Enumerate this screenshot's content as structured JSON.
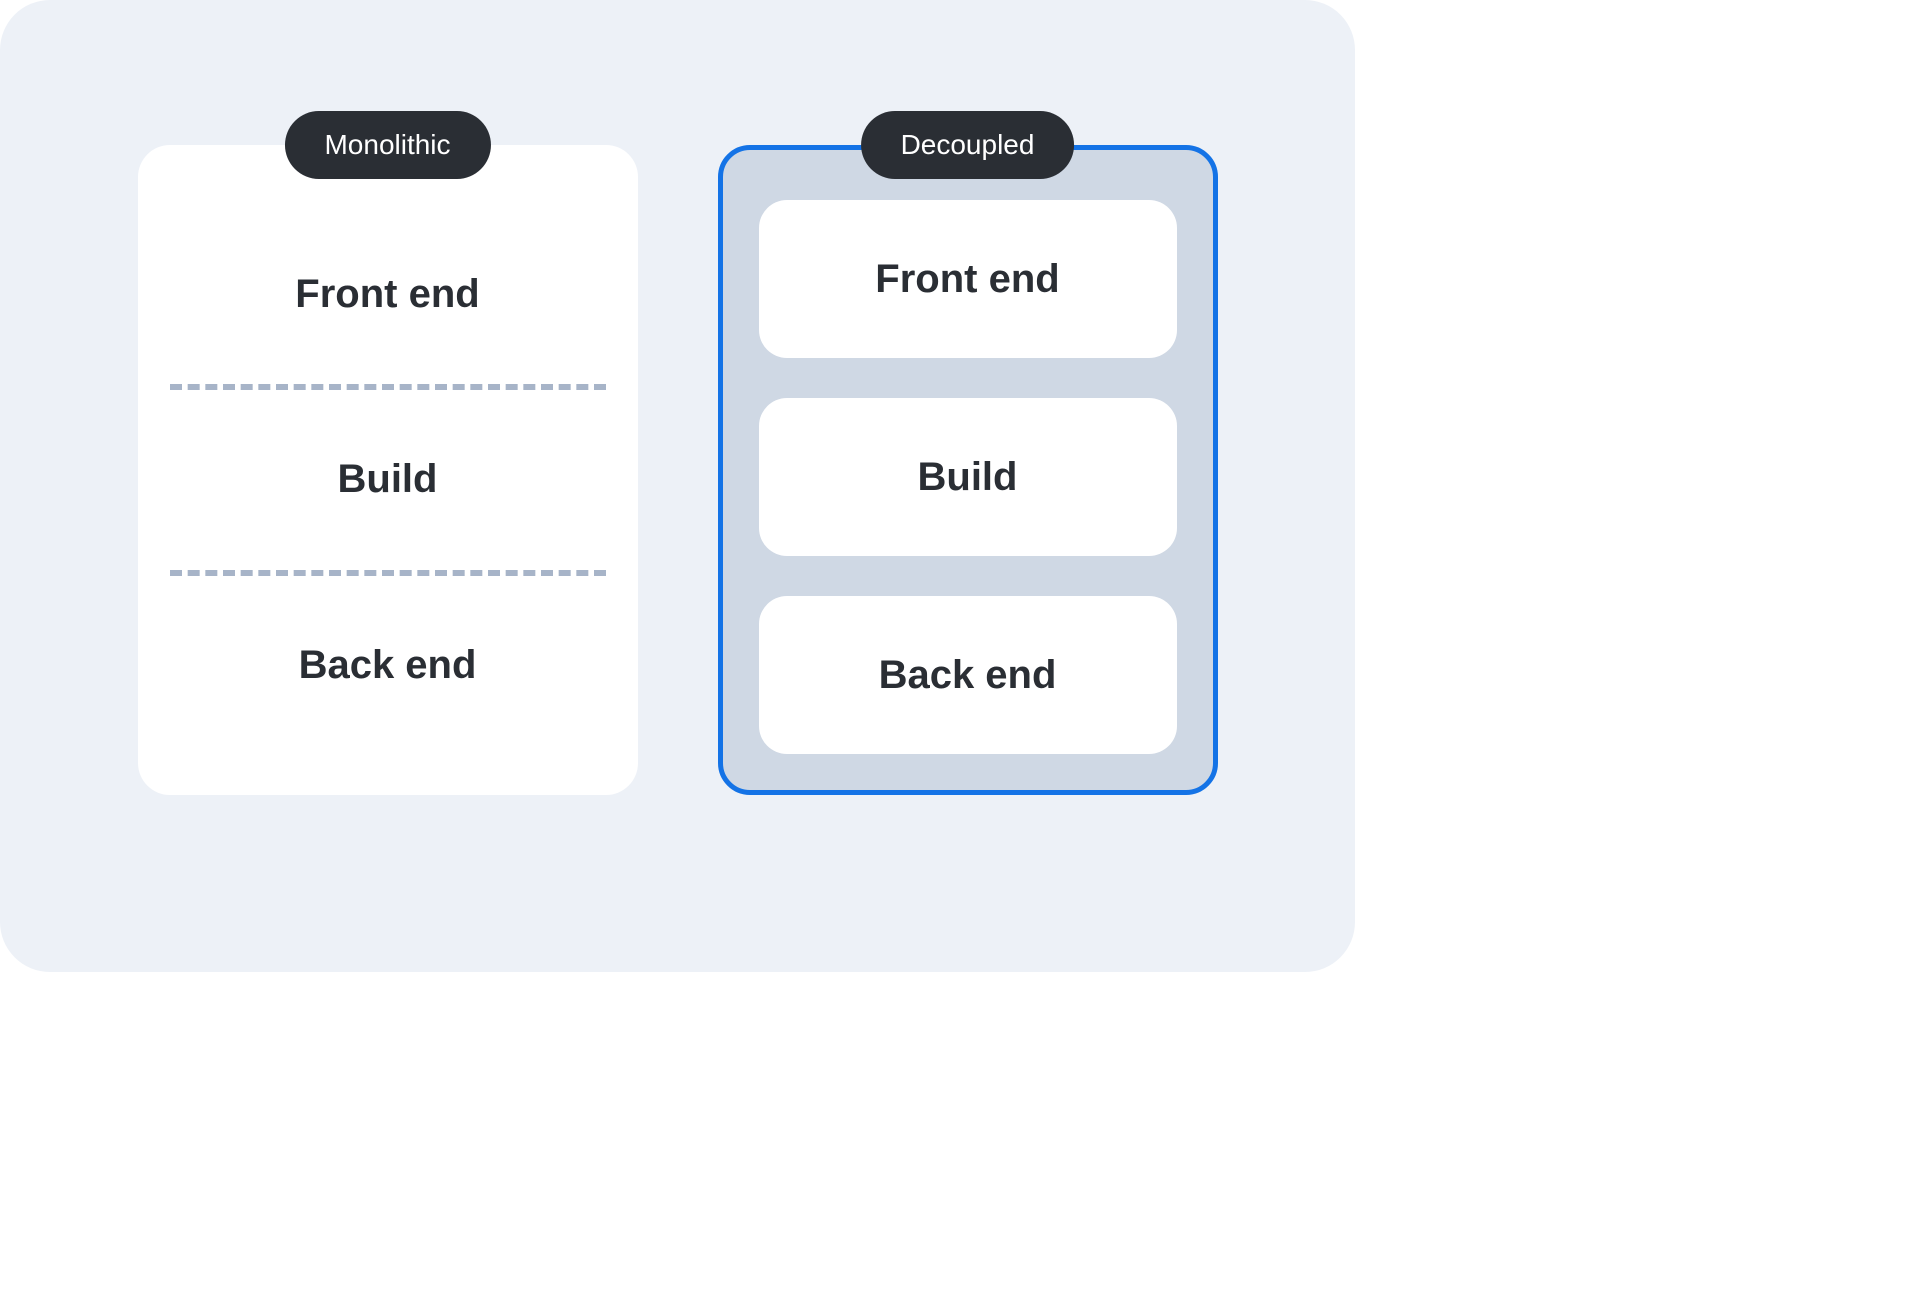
{
  "architectures": {
    "monolithic": {
      "badge": "Monolithic",
      "layers": [
        "Front end",
        "Build",
        "Back end"
      ]
    },
    "decoupled": {
      "badge": "Decoupled",
      "layers": [
        "Front end",
        "Build",
        "Back end"
      ]
    }
  },
  "colors": {
    "canvas_bg": "#edf1f7",
    "badge_bg": "#2a2e34",
    "decoupled_border": "#1473e6",
    "decoupled_bg": "#cfd8e4",
    "dash": "#a7b4c8",
    "text": "#2a2e34"
  }
}
